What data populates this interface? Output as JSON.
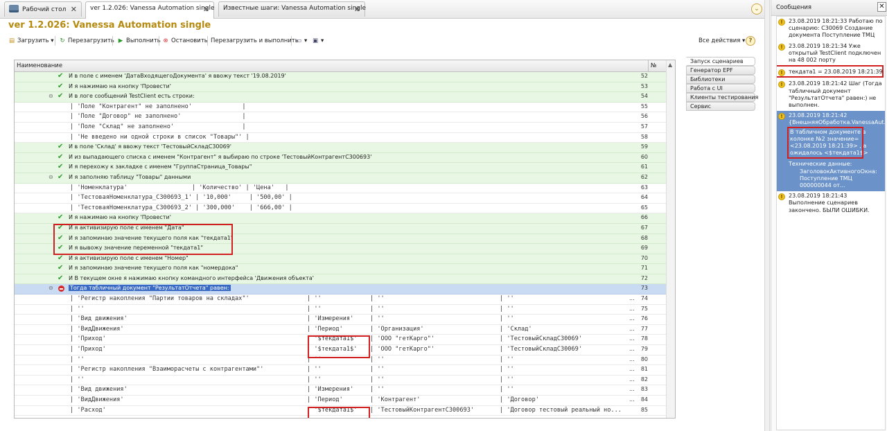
{
  "tabs": [
    {
      "label": "Рабочий стол"
    },
    {
      "label": "ver 1.2.026: Vanessa Automation single"
    },
    {
      "label": "Известные шаги: Vanessa Automation single"
    }
  ],
  "window_title": "ver 1.2.026: Vanessa Automation single",
  "toolbar": {
    "load": "Загрузить",
    "reload": "Перезагрузить",
    "run": "Выполнить",
    "stop": "Остановить",
    "reload_run": "Перезагрузить и выполнить",
    "all_actions": "Все действия",
    "help": "?"
  },
  "grid": {
    "col_name": "Наименование",
    "col_num": "№",
    "rows": [
      {
        "n": "52",
        "type": "step",
        "text": "И в поле с именем 'ДатаВходящегоДокумента' я ввожу текст '19.08.2019'"
      },
      {
        "n": "53",
        "type": "step",
        "text": "И я нажимаю на кнопку 'Провести'"
      },
      {
        "n": "54",
        "type": "step",
        "tog": true,
        "text": "И в логе сообщений TestClient есть строки:"
      },
      {
        "n": "55",
        "type": "data",
        "text": "| 'Поле \"Контрагент\" не заполнено'              |"
      },
      {
        "n": "56",
        "type": "data",
        "text": "| 'Поле \"Договор\" не заполнено'                 |"
      },
      {
        "n": "57",
        "type": "data",
        "text": "| 'Поле \"Склад\" не заполнено'                   |"
      },
      {
        "n": "58",
        "type": "data",
        "text": "| 'Не введено ни одной строки в список \"Товары\"' |"
      },
      {
        "n": "59",
        "type": "step",
        "text": "И в поле 'Склад' я ввожу текст 'ТестовыйСкладС30069'"
      },
      {
        "n": "60",
        "type": "step",
        "text": "И из выпадающего списка с именем \"Контрагент\" я выбираю по строке 'ТестовыйКонтрагентС300693'"
      },
      {
        "n": "61",
        "type": "step",
        "text": "И я перехожу к закладке с именем \"ГруппаСтраница_Товары\""
      },
      {
        "n": "62",
        "type": "step",
        "tog": true,
        "text": "И я заполняю таблицу \"Товары\" данными"
      },
      {
        "n": "63",
        "type": "data",
        "text": "| 'Номенклатура'                  | 'Количество' | 'Цена'   |"
      },
      {
        "n": "64",
        "type": "data",
        "text": "| 'ТестоваяНоменклатура_С300693_1' | '10,000'     | '500,00' |"
      },
      {
        "n": "65",
        "type": "data",
        "text": "| 'ТестоваяНоменклатура_С300693_2' | '300,000'    | '666,00' |"
      },
      {
        "n": "66",
        "type": "step",
        "text": "И я нажимаю на кнопку 'Провести'"
      },
      {
        "n": "67",
        "type": "step",
        "text": "И я активизирую поле с именем \"Дата\""
      },
      {
        "n": "68",
        "type": "step",
        "text": "И я запоминаю значение текущего поля как \"текдата1\""
      },
      {
        "n": "69",
        "type": "step",
        "text": "И я вывожу значение переменной \"текдата1\""
      },
      {
        "n": "70",
        "type": "step",
        "text": "И я активизирую поле с именем \"Номер\""
      },
      {
        "n": "71",
        "type": "step",
        "text": "И я запоминаю значение текущего поля как \"номердока\""
      },
      {
        "n": "72",
        "type": "step",
        "text": "И В текущем окне я нажимаю кнопку командного интерфейса 'Движения объекта'"
      },
      {
        "n": "73",
        "type": "fail",
        "tog": true,
        "text": "Тогда табличный документ \"РезультатОтчета\" равен:"
      },
      {
        "n": "74",
        "type": "data",
        "c1": "| 'Регистр накопления \"Партии товаров на складах\"'",
        "c2": "| ''",
        "c3": "| ''",
        "c4": "| ''",
        "dots": "..."
      },
      {
        "n": "75",
        "type": "data",
        "c1": "| ''",
        "c2": "| ''",
        "c3": "| ''",
        "c4": "| ''",
        "dots": "..."
      },
      {
        "n": "76",
        "type": "data",
        "c1": "| 'Вид движения'",
        "c2": "| 'Измерения'",
        "c3": "| ''",
        "c4": "| ''",
        "dots": "..."
      },
      {
        "n": "77",
        "type": "data",
        "c1": "| 'ВидДвижения'",
        "c2": "| 'Период'",
        "c3": "| 'Организация'",
        "c4": "| 'Склад'",
        "dots": "..."
      },
      {
        "n": "78",
        "type": "data",
        "c1": "| 'Приход'",
        "c2": "| '$текдата1$'",
        "c3": "| 'ООО \"гетКарго\"'",
        "c4": "| 'ТестовыйСкладС30069'",
        "dots": "..."
      },
      {
        "n": "79",
        "type": "data",
        "c1": "| 'Приход'",
        "c2": "| '$текдата1$'",
        "c3": "| 'ООО \"гетКарго\"'",
        "c4": "| 'ТестовыйСкладС30069'",
        "dots": "..."
      },
      {
        "n": "80",
        "type": "data",
        "c1": "| ''",
        "c2": "| ''",
        "c3": "| ''",
        "c4": "| ''",
        "dots": "..."
      },
      {
        "n": "81",
        "type": "data",
        "c1": "| 'Регистр накопления \"Взаиморасчеты с контрагентами\"'",
        "c2": "| ''",
        "c3": "| ''",
        "c4": "| ''",
        "dots": "..."
      },
      {
        "n": "82",
        "type": "data",
        "c1": "| ''",
        "c2": "| ''",
        "c3": "| ''",
        "c4": "| ''",
        "dots": "..."
      },
      {
        "n": "83",
        "type": "data",
        "c1": "| 'Вид движения'",
        "c2": "| 'Измерения'",
        "c3": "| ''",
        "c4": "| ''",
        "dots": "..."
      },
      {
        "n": "84",
        "type": "data",
        "c1": "| 'ВидДвижения'",
        "c2": "| 'Период'",
        "c3": "| 'Контрагент'",
        "c4": "| 'Договор'",
        "dots": "..."
      },
      {
        "n": "85",
        "type": "data",
        "c1": "| 'Расход'",
        "c2": "| '$текдата1$'",
        "c3": "| 'ТестовыйКонтрагентС300693'",
        "c4": "| 'Договор тестовый реальный но...",
        "dots": ""
      }
    ]
  },
  "side_tabs": [
    "Запуск сценариев",
    "Генератор EPF",
    "Библиотеки",
    "Работа с UI",
    "Клиенты тестирования",
    "Сервис"
  ],
  "messages": {
    "title": "Сообщения",
    "items": [
      {
        "text": "23.08.2019 18:21:33 Работаю по сценарию: С30069 Создание документа Поступление ТМЦ"
      },
      {
        "text": "23.08.2019 18:21:34 Уже открытый TestClient подключен на 48 002 порту"
      },
      {
        "text": "текдата1 = 23.08.2019 18:21:39"
      },
      {
        "text": "23.08.2019 18:21:42 Шаг (Тогда табличный документ \"РезультатОтчета\" равен:) не выполнен."
      },
      {
        "l1": "23.08.2019 18:21:42",
        "l2": "{ВнешняяОбработка.VanessaAut...",
        "l3": "В табличном документе в колонке №2 значение= <23.08.2019 18:21:39> , а ожидалось <$текдата1$>",
        "l4": "Технические данные:",
        "l5": "ЗаголовокАктивногоОкна: Поступление ТМЦ 000000044 от..."
      },
      {
        "text": "23.08.2019 18:21:43 Выполнение сценариев закончено. БЫЛИ ОШИБКИ."
      }
    ]
  },
  "colors": {
    "title": "#b58a0f",
    "green_row": "#e8f7e3",
    "selected_row": "#c9daf3",
    "highlight": "#d11f1f",
    "message_selected": "#6b93c9"
  }
}
